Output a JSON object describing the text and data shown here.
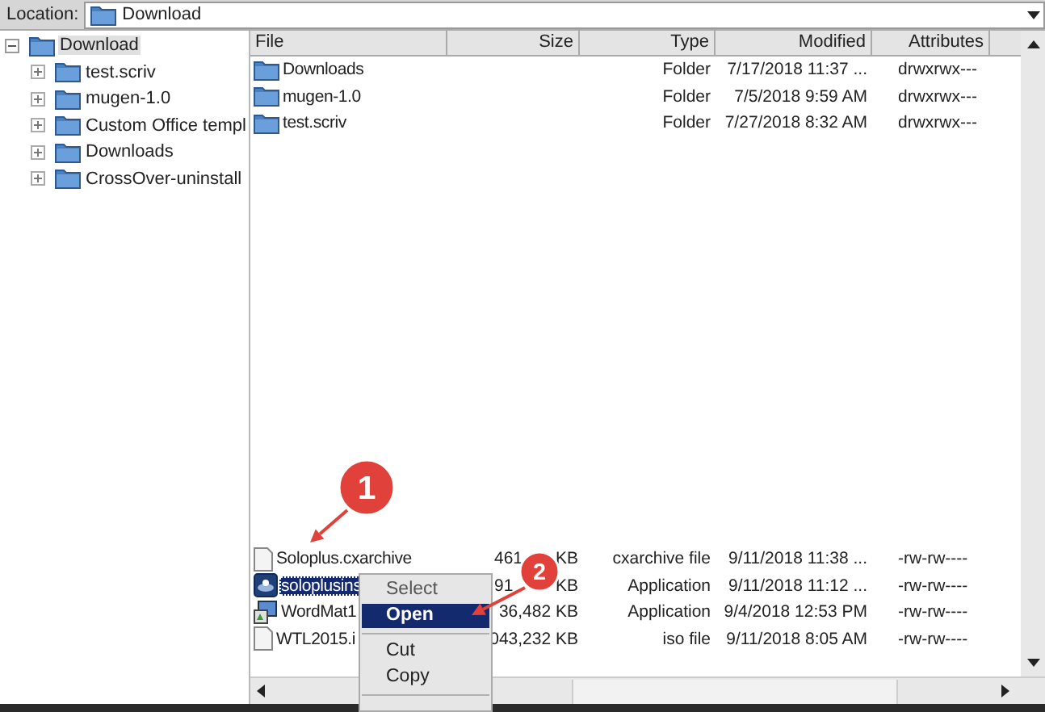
{
  "location": {
    "label": "Location:",
    "value": "Download"
  },
  "tree": {
    "label": "Download",
    "expanded": true,
    "selected": true,
    "children": [
      {
        "label": "test.scriv",
        "expanded": false
      },
      {
        "label": "mugen-1.0",
        "expanded": false
      },
      {
        "label": "Custom Office templ",
        "expanded": false
      },
      {
        "label": "Downloads",
        "expanded": false
      },
      {
        "label": "CrossOver-uninstall",
        "expanded": false
      }
    ]
  },
  "file_list": {
    "columns": [
      "File",
      "Size",
      "Type",
      "Modified",
      "Attributes"
    ],
    "rows_top": [
      {
        "kind": "folder",
        "name": "Downloads",
        "type": "Folder",
        "modified": "7/17/2018 11:37 ...",
        "attributes": "drwxrwx---",
        "selected": false
      },
      {
        "kind": "folder",
        "name": "mugen-1.0",
        "type": "Folder",
        "modified": "7/5/2018 9:59 AM",
        "attributes": "drwxrwx---",
        "selected": false
      },
      {
        "kind": "folder",
        "name": "test.scriv",
        "type": "Folder",
        "modified": "7/27/2018 8:32 AM",
        "attributes": "drwxrwx---",
        "selected": false
      }
    ],
    "rows_bottom": [
      {
        "kind": "file",
        "name": "Soloplus.cxarchive",
        "size": [
          "461",
          "KB"
        ],
        "type": "cxarchive file",
        "modified": "9/11/2018 11:38 ...",
        "attributes": "-rw-rw----",
        "selected": false
      },
      {
        "kind": "installer",
        "name": "soloplusins",
        "size": [
          "91",
          "KB"
        ],
        "type": "Application",
        "modified": "9/11/2018 11:12 ...",
        "attributes": "-rw-rw----",
        "selected": true
      },
      {
        "kind": "application",
        "name": "WordMat1",
        "size": [
          "36,482 KB"
        ],
        "type": "Application",
        "modified": "9/4/2018 12:53 PM",
        "attributes": "-rw-rw----",
        "selected": false
      },
      {
        "kind": "file",
        "name": "WTL2015.i",
        "size": [
          "043,232 KB"
        ],
        "type": "iso file",
        "modified": "9/11/2018 8:05 AM",
        "attributes": "-rw-rw----",
        "selected": false
      }
    ]
  },
  "context_menu": [
    {
      "kind": "item",
      "label": "Select",
      "selected": false,
      "disabled": true
    },
    {
      "kind": "item",
      "label": "Open",
      "selected": true,
      "disabled": false
    },
    {
      "kind": "separator"
    },
    {
      "kind": "item",
      "label": "Cut",
      "selected": false,
      "disabled": false
    },
    {
      "kind": "item",
      "label": "Copy",
      "selected": false,
      "disabled": false
    },
    {
      "kind": "separator"
    }
  ],
  "callouts": [
    {
      "label": "1"
    },
    {
      "label": "2"
    }
  ]
}
